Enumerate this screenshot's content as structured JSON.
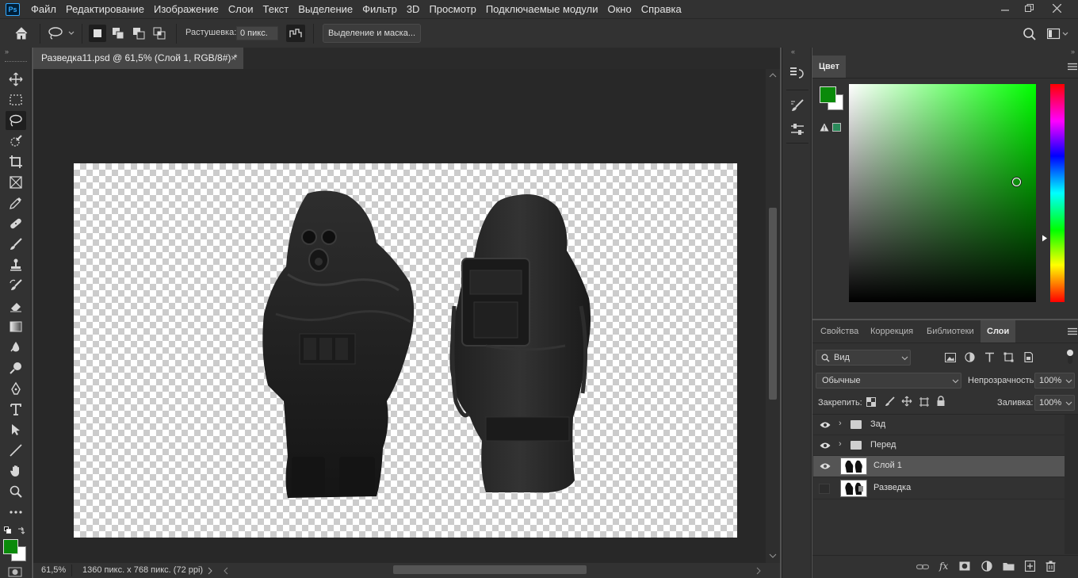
{
  "app": {
    "logo_text": "Ps",
    "menu": [
      "Файл",
      "Редактирование",
      "Изображение",
      "Слои",
      "Текст",
      "Выделение",
      "Фильтр",
      "3D",
      "Просмотр",
      "Подключаемые модули",
      "Окно",
      "Справка"
    ],
    "window_controls": [
      "minimize",
      "restore",
      "close"
    ]
  },
  "options": {
    "feather_label": "Растушевка:",
    "feather_value": "0 пикс.",
    "select_mask_button": "Выделение и маска..."
  },
  "document": {
    "tab_title": "Разведка11.psd @ 61,5% (Слой 1, RGB/8#) *",
    "close_glyph": "×",
    "zoom": "61,5%",
    "doc_info": "1360 пикс. x 768 пикс. (72 ppi)"
  },
  "tools": [
    "move-tool",
    "marquee-tool",
    "lasso-tool",
    "quick-select-tool",
    "crop-tool",
    "frame-tool",
    "eyedropper-tool",
    "healing-brush-tool",
    "brush-tool",
    "clone-stamp-tool",
    "history-brush-tool",
    "eraser-tool",
    "gradient-tool",
    "blur-tool",
    "dodge-tool",
    "pen-tool",
    "type-tool",
    "path-select-tool",
    "line-tool",
    "hand-tool",
    "zoom-tool",
    "more-tools"
  ],
  "colors": {
    "foreground": "#0a8a0a",
    "background": "#ffffff",
    "hue_marker_color": "#00ff00"
  },
  "color_panel": {
    "tab": "Цвет"
  },
  "layers_panel": {
    "tabs": [
      "Свойства",
      "Коррекция",
      "Библиотеки",
      "Слои"
    ],
    "active_tab": "Слои",
    "filter_value": "Вид",
    "blend_mode": "Обычные",
    "opacity_label": "Непрозрачность:",
    "opacity_value": "100%",
    "lock_label": "Закрепить:",
    "fill_label": "Заливка:",
    "fill_value": "100%",
    "layers": [
      {
        "name": "Зад",
        "type": "group",
        "visible": true,
        "selected": false
      },
      {
        "name": "Перед",
        "type": "group",
        "visible": true,
        "selected": false
      },
      {
        "name": "Слой 1",
        "type": "layer",
        "visible": true,
        "selected": true
      },
      {
        "name": "Разведка",
        "type": "layer",
        "visible": false,
        "selected": false
      }
    ]
  }
}
